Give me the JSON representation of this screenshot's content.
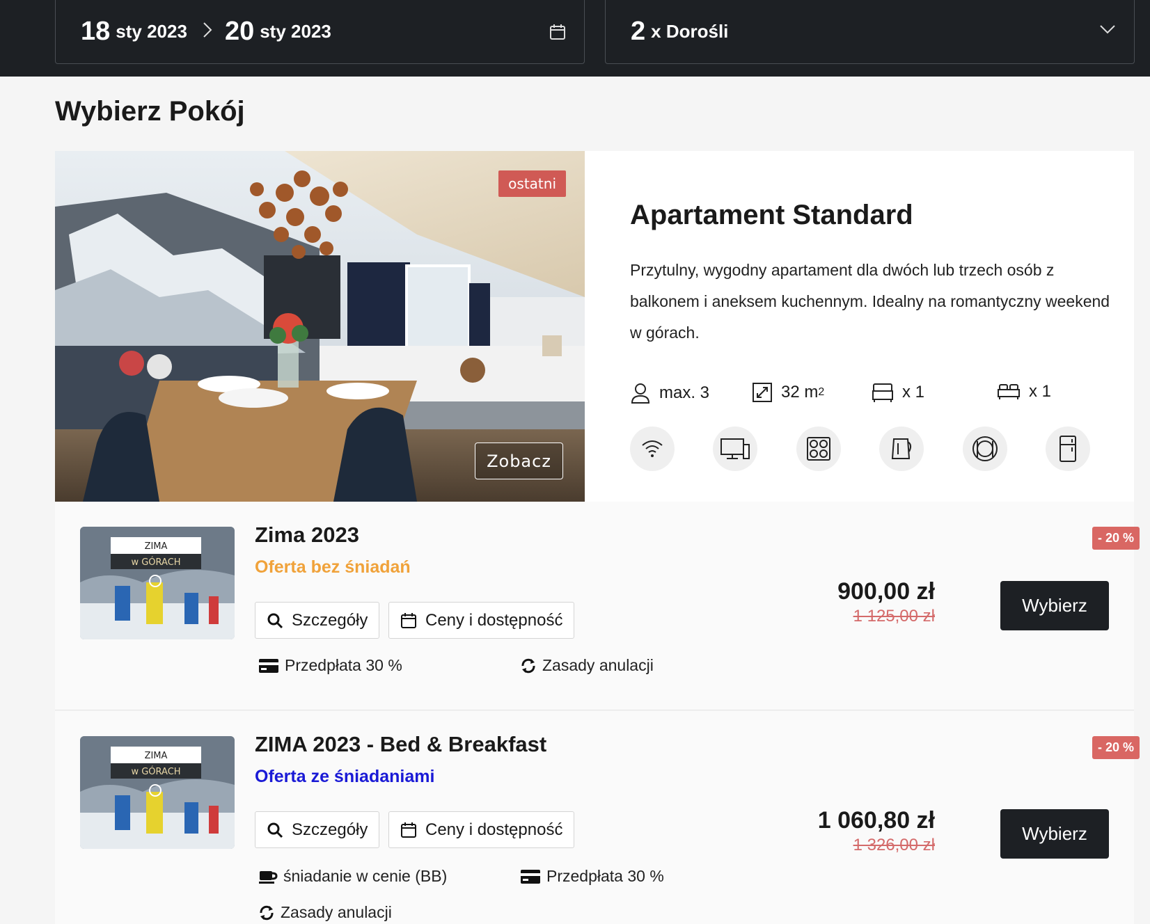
{
  "search": {
    "checkin_day": "18",
    "checkin_rest": "sty 2023",
    "checkout_day": "20",
    "checkout_rest": "sty 2023",
    "guests_count": "2",
    "guests_label": "x Dorośli"
  },
  "page_title": "Wybierz Pokój",
  "room": {
    "badge": "ostatni",
    "see_button": "Zobacz",
    "name": "Apartament Standard",
    "description": "Przytulny, wygodny apartament dla dwóch lub trzech osób z balkonem i aneksem kuchennym. Idealny na romantyczny weekend w górach.",
    "specs": {
      "capacity": "max. 3",
      "area_value": "32 m",
      "area_unit_sup": "2",
      "single_beds": "x 1",
      "double_beds": "x 1"
    },
    "amenities": [
      "wifi-icon",
      "tv-icon",
      "cooktop-icon",
      "kettle-icon",
      "dining-icon",
      "fridge-icon"
    ]
  },
  "thumb_text": {
    "line1": "ZIMA",
    "line2": "w GÓRACH"
  },
  "offers": [
    {
      "title": "Zima 2023",
      "subtitle": "Oferta bez śniadań",
      "subtitle_color": "#f0a23a",
      "details_label": "Szczegóły",
      "availability_label": "Ceny i dostępność",
      "prepay": "Przedpłata 30 %",
      "cancel": "Zasady anulacji",
      "price": "900,00 zł",
      "old_price": "1 125,00 zł",
      "choose_label": "Wybierz",
      "discount": "- 20 %"
    },
    {
      "title": "ZIMA 2023 - Bed & Breakfast",
      "subtitle": "Oferta ze śniadaniami",
      "subtitle_color": "#1a1ad6",
      "details_label": "Szczegóły",
      "availability_label": "Ceny i dostępność",
      "breakfast": "śniadanie w cenie (BB)",
      "prepay": "Przedpłata 30 %",
      "cancel": "Zasady anulacji",
      "price": "1 060,80 zł",
      "old_price": "1 326,00 zł",
      "choose_label": "Wybierz",
      "discount": "- 20 %"
    }
  ],
  "colors": {
    "topbar": "#1d2024",
    "discount": "#d96763",
    "old_price": "#d46a6a",
    "badge": "#d05a55"
  }
}
